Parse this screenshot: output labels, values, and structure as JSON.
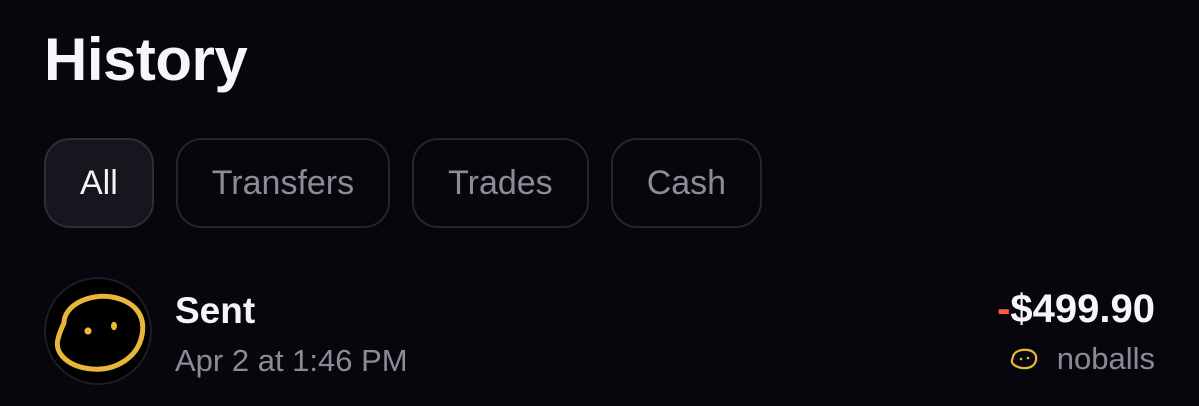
{
  "header": {
    "title": "History"
  },
  "filters": [
    {
      "label": "All",
      "active": true
    },
    {
      "label": "Transfers",
      "active": false
    },
    {
      "label": "Trades",
      "active": false
    },
    {
      "label": "Cash",
      "active": false
    }
  ],
  "transactions": [
    {
      "title": "Sent",
      "timestamp": "Apr 2 at 1:46 PM",
      "amount_sign": "-",
      "amount_value": "$499.90",
      "recipient": "noballs",
      "avatar_icon": "potato-doodle-icon"
    }
  ],
  "colors": {
    "background": "#07060d",
    "negative_sign": "#ff5a3c",
    "doodle": "#e8b73a",
    "muted_text": "#8c8b95"
  }
}
